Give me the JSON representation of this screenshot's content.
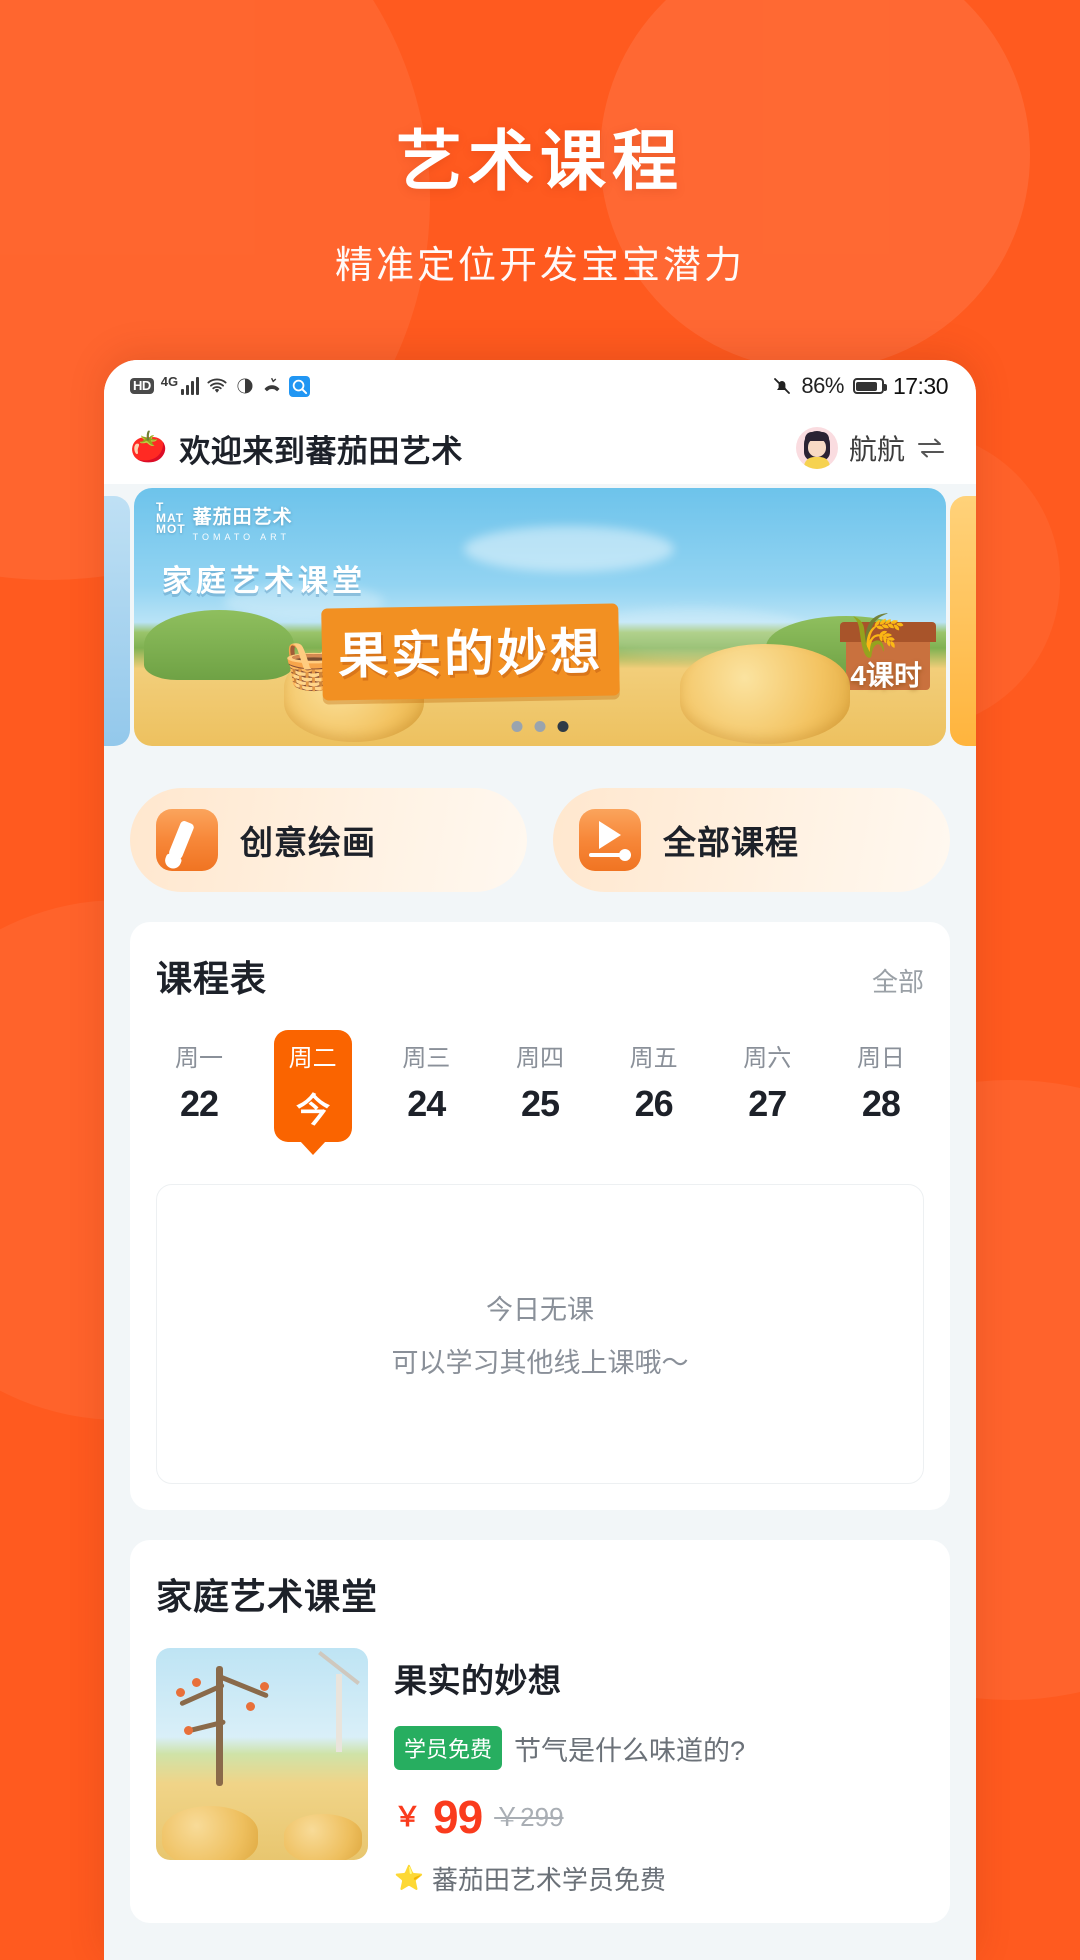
{
  "hero": {
    "title": "艺术课程",
    "subtitle": "精准定位开发宝宝潜力"
  },
  "colors": {
    "brand_orange": "#FF5A1F",
    "accent_orange": "#FA6400",
    "price_red": "#FA3B1D",
    "tag_green": "#27AE60",
    "status_blue": "#2196F3"
  },
  "statusbar": {
    "hd_label": "HD",
    "network": "4G",
    "icons": [
      "hd-icon",
      "signal-bars-icon",
      "wifi-icon",
      "eye-icon",
      "call-icon",
      "search-icon"
    ],
    "battery_percent": "86%",
    "time": "17:30",
    "mute_icon": "bell-off-icon"
  },
  "appheader": {
    "logo_icon": "tomato-icon",
    "welcome_title": "欢迎来到蕃茄田艺术",
    "user_name": "航航",
    "switch_icon": "switch-account-icon",
    "avatar_icon": "avatar"
  },
  "banner": {
    "logo_mark_top": "T",
    "logo_mark_mid": "MAT",
    "logo_mark_bot": "MOT",
    "logo_zh": "蕃茄田艺术",
    "logo_en": "TOMATO ART",
    "subtitle": "家庭艺术课堂",
    "headline": "果实的妙想",
    "lessons": "4课时",
    "dots_total": 3,
    "dots_active_index": 2
  },
  "quick_actions": [
    {
      "label": "创意绘画",
      "icon": "brush-icon"
    },
    {
      "label": "全部课程",
      "icon": "play-video-icon"
    }
  ],
  "schedule": {
    "title": "课程表",
    "more_label": "全部",
    "days": [
      {
        "weekday": "周一",
        "date": "22",
        "active": false
      },
      {
        "weekday": "周二",
        "date": "今",
        "active": true
      },
      {
        "weekday": "周三",
        "date": "24",
        "active": false
      },
      {
        "weekday": "周四",
        "date": "25",
        "active": false
      },
      {
        "weekday": "周五",
        "date": "26",
        "active": false
      },
      {
        "weekday": "周六",
        "date": "27",
        "active": false
      },
      {
        "weekday": "周日",
        "date": "28",
        "active": false
      }
    ],
    "empty_line1": "今日无课",
    "empty_line2": "可以学习其他线上课哦～"
  },
  "family_class": {
    "title": "家庭艺术课堂",
    "course": {
      "name": "果实的妙想",
      "tag": "学员免费",
      "desc": "节气是什么味道的?",
      "currency": "￥",
      "price": "99",
      "price_original": "￥299",
      "note_icon": "star-icon",
      "note": "蕃茄田艺术学员免费",
      "thumb_icon": "course-thumbnail"
    }
  }
}
